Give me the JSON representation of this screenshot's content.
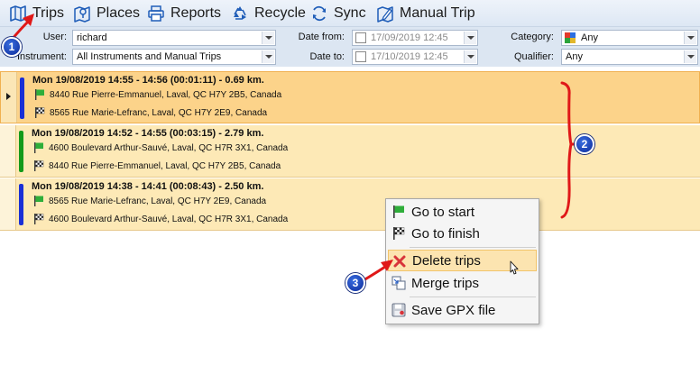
{
  "toolbar": {
    "items": [
      {
        "label": "Trips",
        "icon": "map-icon"
      },
      {
        "label": "Places",
        "icon": "places-icon"
      },
      {
        "label": "Reports",
        "icon": "printer-icon"
      },
      {
        "label": "Recycle",
        "icon": "recycle-icon"
      },
      {
        "label": "Sync",
        "icon": "sync-icon"
      },
      {
        "label": "Manual Trip",
        "icon": "manual-trip-icon"
      }
    ]
  },
  "filters": {
    "user_label": "User:",
    "user_value": "richard",
    "instrument_label": "Instrument:",
    "instrument_value": "All Instruments and Manual Trips",
    "date_from_label": "Date from:",
    "date_from_value": "17/09/2019 12:45",
    "date_to_label": "Date to:",
    "date_to_value": "17/10/2019 12:45",
    "category_label": "Category:",
    "category_value": "Any",
    "qualifier_label": "Qualifier:",
    "qualifier_value": "Any"
  },
  "trips": [
    {
      "title": "Mon 19/08/2019  14:55 - 14:56  (00:01:11) - 0.69 km.",
      "start": "8440 Rue Pierre-Emmanuel, Laval, QC H7Y 2B5, Canada",
      "finish": "8565 Rue Marie-Lefranc, Laval, QC H7Y 2E9, Canada",
      "color": "#1a2fd6",
      "selected": true
    },
    {
      "title": "Mon 19/08/2019  14:52 - 14:55  (00:03:15) - 2.79 km.",
      "start": "4600 Boulevard Arthur-Sauvé, Laval, QC H7R 3X1, Canada",
      "finish": "8440 Rue Pierre-Emmanuel, Laval, QC H7Y 2B5, Canada",
      "color": "#149a1a",
      "selected": false
    },
    {
      "title": "Mon 19/08/2019  14:38 - 14:41  (00:08:43) - 2.50 km.",
      "start": "8565 Rue Marie-Lefranc, Laval, QC H7Y 2E9, Canada",
      "finish": "4600 Boulevard Arthur-Sauvé, Laval, QC H7R 3X1, Canada",
      "color": "#1a2fd6",
      "selected": false
    }
  ],
  "context_menu": {
    "items": [
      {
        "label": "Go to start",
        "icon": "start-flag-icon"
      },
      {
        "label": "Go to finish",
        "icon": "finish-flag-icon"
      },
      {
        "label": "Delete trips",
        "icon": "delete-icon",
        "highlighted": true
      },
      {
        "label": "Merge trips",
        "icon": "merge-icon"
      },
      {
        "label": "Save GPX file",
        "icon": "save-gpx-icon"
      }
    ]
  },
  "annotations": {
    "badge_1": "1",
    "badge_2": "2",
    "badge_3": "3"
  },
  "colors": {
    "accent_blue": "#1a2fd6",
    "accent_green": "#149a1a",
    "annotation_red": "#e01818",
    "selected_row": "#fcd38a",
    "row": "#fde9b6"
  }
}
